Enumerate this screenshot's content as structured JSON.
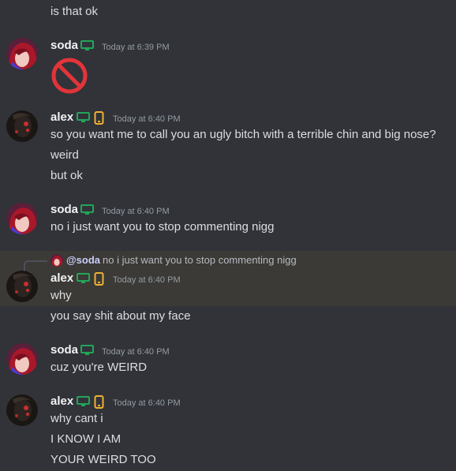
{
  "messages": {
    "m0": {
      "lines": [
        "is that ok"
      ]
    },
    "m1": {
      "author": "soda",
      "timestamp": "Today at 6:39 PM",
      "content_icon": "prohibited-emoji"
    },
    "m2": {
      "author": "alex",
      "timestamp": "Today at 6:40 PM",
      "lines": [
        "so you want me to call you an ugly bitch with a terrible chin and big nose?",
        "weird",
        "but ok"
      ]
    },
    "m3": {
      "author": "soda",
      "timestamp": "Today at 6:40 PM",
      "lines": [
        "no i just want you to stop commenting nigg"
      ]
    },
    "m4": {
      "author": "alex",
      "timestamp": "Today at 6:40 PM",
      "reply": {
        "name": "@soda",
        "text": "no i just want you to stop commenting nigg"
      },
      "lines": [
        "why",
        "you say shit about my face"
      ]
    },
    "m5": {
      "author": "soda",
      "timestamp": "Today at 6:40 PM",
      "lines": [
        "cuz you're WEIRD"
      ]
    },
    "m6": {
      "author": "alex",
      "timestamp": "Today at 6:40 PM",
      "lines": [
        "why cant i",
        "I KNOW I AM",
        "YOUR WEIRD TOO"
      ]
    }
  },
  "icons": {
    "desktop": "desktop-icon",
    "mobile": "mobile-phone-icon",
    "prohibited": "prohibited-icon"
  },
  "colors": {
    "background": "#313338",
    "highlight": "#3b3a36",
    "desktop_status": "#23a55a",
    "mobile_status": "#f0b232",
    "prohibited": "#e2343a"
  }
}
